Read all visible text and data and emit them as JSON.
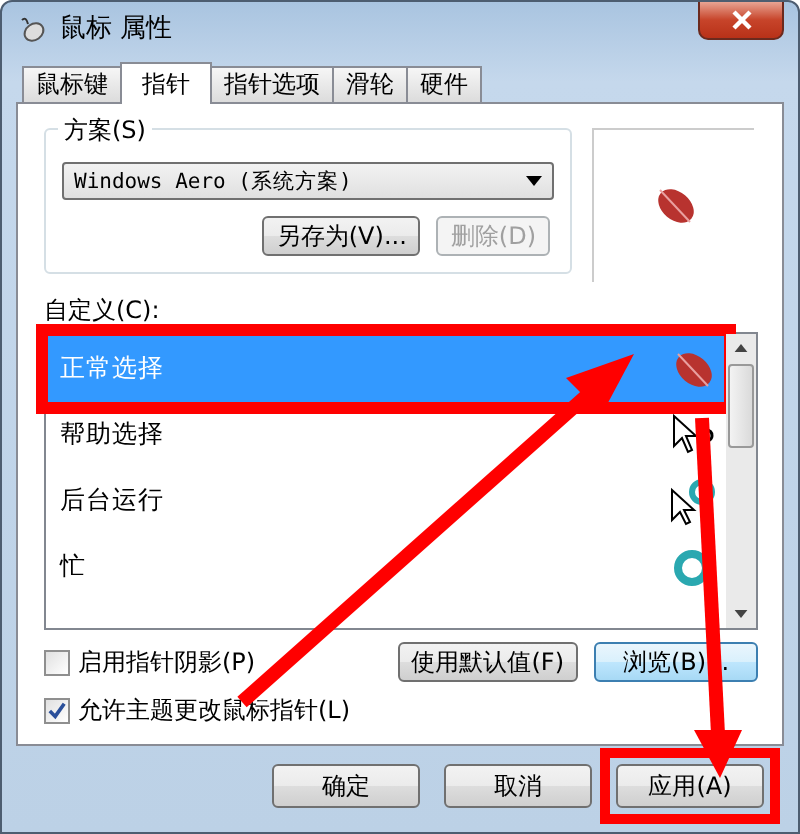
{
  "window": {
    "title": "鼠标 属性"
  },
  "tabs": [
    {
      "label": "鼠标键",
      "selected": false
    },
    {
      "label": "指针",
      "selected": true
    },
    {
      "label": "指针选项",
      "selected": false
    },
    {
      "label": "滑轮",
      "selected": false
    },
    {
      "label": "硬件",
      "selected": false
    }
  ],
  "scheme": {
    "label": "方案(S)",
    "value": "Windows Aero (系统方案)",
    "buttons": [
      {
        "label": "另存为(V)...",
        "disabled": false
      },
      {
        "label": "删除(D)",
        "disabled": true
      }
    ]
  },
  "customize": {
    "label": "自定义(C):",
    "items": [
      {
        "name": "正常选择",
        "kind": "leaf",
        "selected": true,
        "highlighted": true
      },
      {
        "name": "帮助选择",
        "kind": "help",
        "selected": false,
        "highlighted": false
      },
      {
        "name": "后台运行",
        "kind": "working",
        "selected": false,
        "highlighted": false
      },
      {
        "name": "忙",
        "kind": "busy",
        "selected": false,
        "highlighted": false
      }
    ]
  },
  "options": [
    {
      "label": "启用指针阴影(P)",
      "checked": false
    },
    {
      "label": "允许主题更改鼠标指针(L)",
      "checked": true
    }
  ],
  "list_buttons": [
    {
      "label": "使用默认值(F)",
      "focused": false
    },
    {
      "label": "浏览(B)...",
      "focused": true
    }
  ],
  "footer_buttons": [
    {
      "label": "确定",
      "highlighted": false
    },
    {
      "label": "取消",
      "highlighted": false
    },
    {
      "label": "应用(A)",
      "highlighted": true
    }
  ]
}
